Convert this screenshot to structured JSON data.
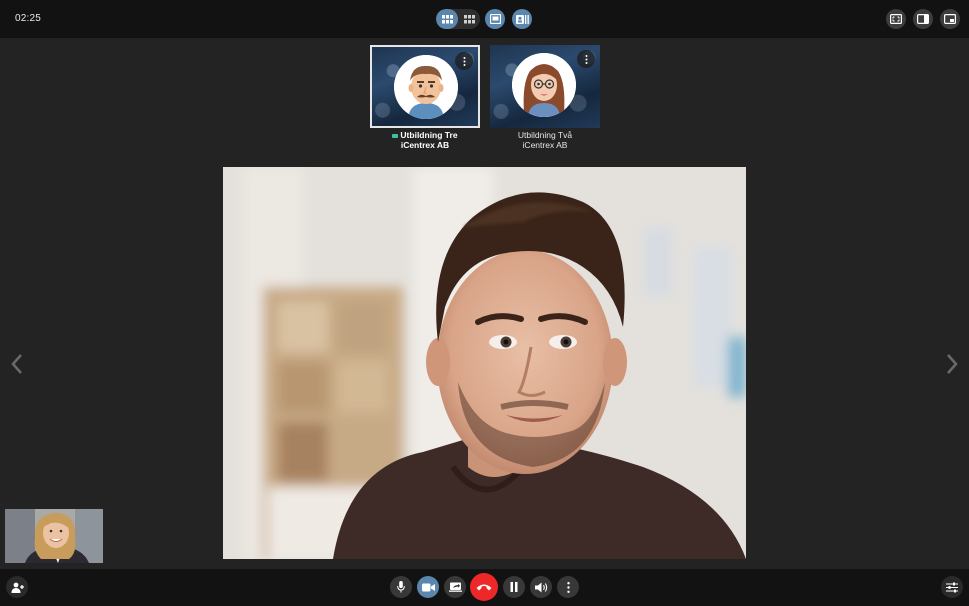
{
  "call": {
    "timer": "02:25"
  },
  "participants": [
    {
      "name": "Utbildning Tre",
      "org": "iCentrex AB",
      "selected": true,
      "camera_on": true
    },
    {
      "name": "Utbildning Två",
      "org": "iCentrex AB",
      "selected": false,
      "camera_on": false
    }
  ],
  "icons": {
    "top_left": [
      "grid-layout-icon",
      "tiles-layout-icon",
      "screen-share-view-icon",
      "presentation-view-icon"
    ],
    "top_right": [
      "fullscreen-icon",
      "sidebar-icon",
      "picture-in-picture-icon"
    ],
    "bottom": [
      "add-participant-icon",
      "microphone-icon",
      "camera-icon",
      "share-screen-icon",
      "hang-up-icon",
      "pause-icon",
      "volume-icon",
      "more-options-icon",
      "settings-sliders-icon"
    ]
  },
  "colors": {
    "accent": "#5b86ad",
    "hangup": "#ee2828",
    "bar": "#121212",
    "background": "#232323"
  }
}
